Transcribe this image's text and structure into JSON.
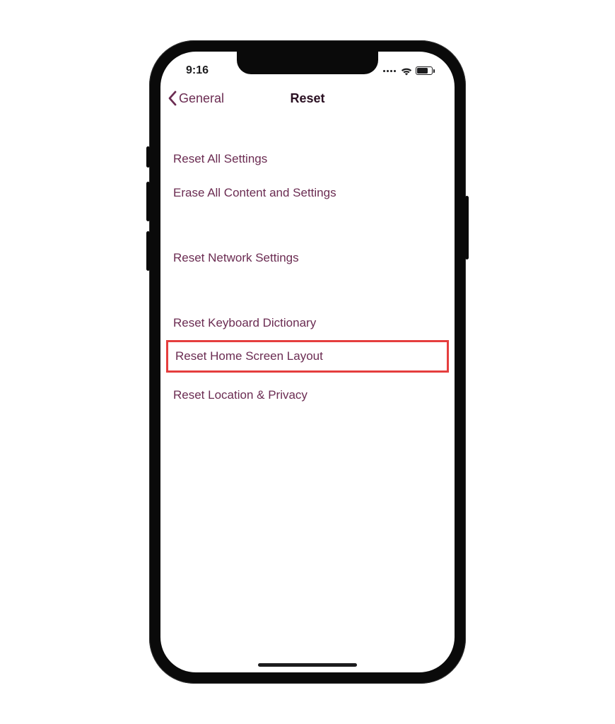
{
  "status_bar": {
    "time": "9:16"
  },
  "nav": {
    "back_label": "General",
    "title": "Reset"
  },
  "reset_options": {
    "group1": {
      "reset_all": "Reset All Settings",
      "erase_all": "Erase All Content and Settings"
    },
    "group2": {
      "network": "Reset Network Settings"
    },
    "group3": {
      "keyboard": "Reset Keyboard Dictionary",
      "home_layout": "Reset Home Screen Layout",
      "location_privacy": "Reset Location & Privacy"
    }
  },
  "highlight": "reset_options.group3.home_layout",
  "colors": {
    "option_text": "#6b2c52",
    "title_text": "#2a1022",
    "highlight_border": "#e53e3e"
  }
}
